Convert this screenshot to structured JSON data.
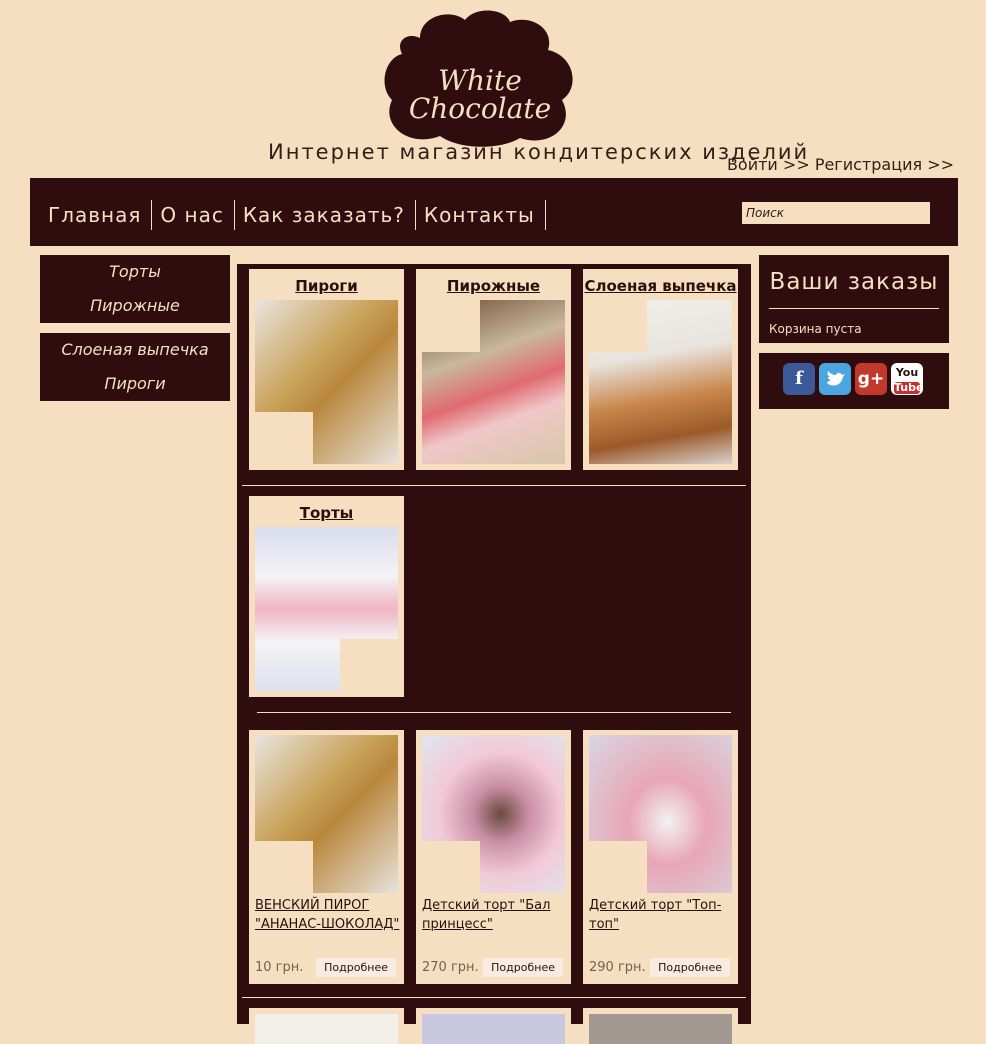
{
  "header": {
    "logo_text_line1": "White",
    "logo_text_line2": "Chocolate",
    "tagline": "Интернет магазин кондитерских изделий",
    "login": "Войти >>",
    "register": "Регистрация >>"
  },
  "nav": {
    "items": [
      "Главная",
      "О нас",
      "Как заказать?",
      "Контакты"
    ],
    "search_placeholder": "Поиск"
  },
  "sidebar": {
    "group1": [
      "Торты",
      "Пирожные"
    ],
    "group2": [
      "Слоеная выпечка",
      "Пироги"
    ]
  },
  "categories": [
    "Пироги",
    "Пирожные",
    "Слоеная выпечка",
    "Торты"
  ],
  "products": [
    {
      "name": "ВЕНСКИЙ ПИРОГ \"АНАНАС-ШОКОЛАД\"",
      "price": "10 грн.",
      "button": "Подробнее"
    },
    {
      "name": "Детский торт \"Бал принцесс\"",
      "price": "270 грн.",
      "button": "Подробнее"
    },
    {
      "name": "Детский торт \"Топ-топ\"",
      "price": "290 грн.",
      "button": "Подробнее"
    }
  ],
  "orders": {
    "title": "Ваши заказы",
    "empty": "Корзина пуста"
  },
  "social": [
    "facebook-icon",
    "twitter-icon",
    "google-plus-icon",
    "youtube-icon"
  ],
  "social_labels": {
    "google": "g+",
    "youtube_top": "You",
    "youtube_bottom": "Tube"
  },
  "colors": {
    "background": "#f5dfc0",
    "dark": "#2f0d0e"
  }
}
